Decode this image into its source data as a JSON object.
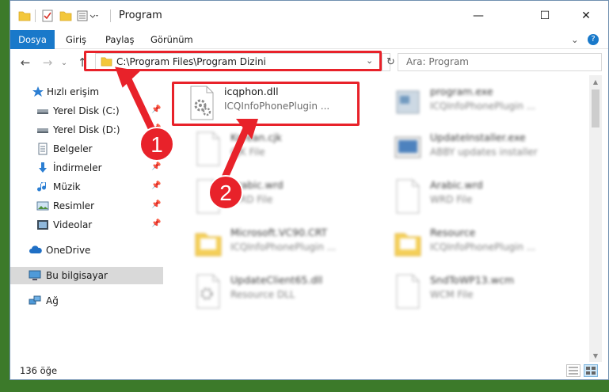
{
  "window": {
    "title": "Program",
    "minimize_label": "—",
    "maximize_label": "☐",
    "close_label": "✕"
  },
  "ribbon": {
    "tabs": [
      "Dosya",
      "Giriş",
      "Paylaş",
      "Görünüm"
    ],
    "help_label": "?"
  },
  "navigation": {
    "address": "C:\\Program Files\\Program Dizini",
    "search_placeholder": "Ara: Program"
  },
  "sidebar": {
    "items": [
      {
        "label": "Hızlı erişim",
        "icon": "star-icon",
        "pinned": false
      },
      {
        "label": "Yerel Disk (C:)",
        "icon": "drive-icon",
        "pinned": true
      },
      {
        "label": "Yerel Disk (D:)",
        "icon": "drive-icon",
        "pinned": true
      },
      {
        "label": "Belgeler",
        "icon": "documents-icon",
        "pinned": true
      },
      {
        "label": "İndirmeler",
        "icon": "download-icon",
        "pinned": true
      },
      {
        "label": "Müzik",
        "icon": "music-icon",
        "pinned": true
      },
      {
        "label": "Resimler",
        "icon": "pictures-icon",
        "pinned": true
      },
      {
        "label": "Videolar",
        "icon": "video-icon",
        "pinned": true
      },
      {
        "label": "OneDrive",
        "icon": "cloud-icon",
        "pinned": false
      },
      {
        "label": "Bu bilgisayar",
        "icon": "computer-icon",
        "pinned": false
      },
      {
        "label": "Ağ",
        "icon": "network-icon",
        "pinned": false
      }
    ]
  },
  "files": [
    {
      "name": "icqphon.dll",
      "desc": "ICQInfoPhonePlugin ...",
      "icon": "dll-gear-icon"
    },
    {
      "name": "program.exe",
      "desc": "ICQInfoPhonePlugin ...",
      "icon": "exe-icon"
    },
    {
      "name": "Korean.cjk",
      "desc": "CJK File",
      "icon": "file-icon"
    },
    {
      "name": "UpdateInstaller.exe",
      "desc": "ABBY updates installer",
      "icon": "installer-icon"
    },
    {
      "name": "Arabic.wrd",
      "desc": "WRD File",
      "icon": "file-icon"
    },
    {
      "name": "Arabic.wrd",
      "desc": "WRD File",
      "icon": "file-icon"
    },
    {
      "name": "Microsoft.VC90.CRT",
      "desc": "ICQInfoPhonePlugin ...",
      "icon": "folder-icon"
    },
    {
      "name": "Resource",
      "desc": "ICQInfoPhonePlugin ...",
      "icon": "folder-icon"
    },
    {
      "name": "UpdateClient65.dll",
      "desc": "Resource DLL",
      "icon": "dll-gear-icon"
    },
    {
      "name": "SndToWP13.wcm",
      "desc": "WCM File",
      "icon": "file-icon"
    }
  ],
  "status": {
    "item_count": "136 öğe"
  },
  "annotations": {
    "badge_1": "1",
    "badge_2": "2",
    "color": "#e8222a"
  }
}
